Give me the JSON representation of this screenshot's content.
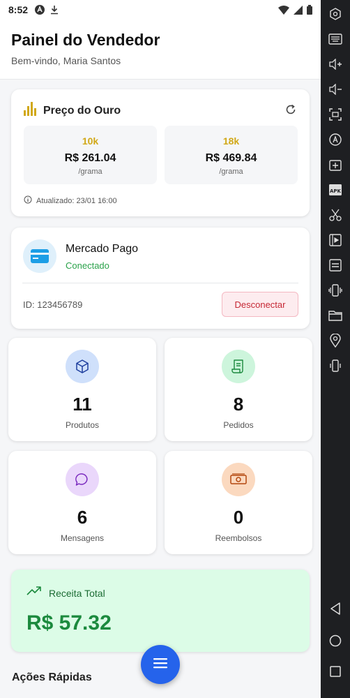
{
  "status_bar": {
    "time": "8:52"
  },
  "header": {
    "title": "Painel do Vendedor",
    "subtitle": "Bem-vindo, Maria Santos"
  },
  "gold": {
    "title": "Preço do Ouro",
    "prices": [
      {
        "karat": "10k",
        "price": "R$ 261.04",
        "unit": "/grama"
      },
      {
        "karat": "18k",
        "price": "R$ 469.84",
        "unit": "/grama"
      }
    ],
    "updated": "Atualizado: 23/01 16:00",
    "accent_color": "#d1a817"
  },
  "mercado_pago": {
    "name": "Mercado Pago",
    "status": "Conectado",
    "id_text": "ID: 123456789",
    "disconnect_label": "Desconectar"
  },
  "stats": [
    {
      "value": "11",
      "label": "Produtos",
      "icon": "box-icon",
      "color": "#cfe0fb"
    },
    {
      "value": "8",
      "label": "Pedidos",
      "icon": "receipt-icon",
      "color": "#cdf5dc"
    },
    {
      "value": "6",
      "label": "Mensagens",
      "icon": "chat-bubble-icon",
      "color": "#ead7fb"
    },
    {
      "value": "0",
      "label": "Reembolsos",
      "icon": "money-icon",
      "color": "#fbd9bf"
    }
  ],
  "revenue": {
    "title": "Receita Total",
    "value": "R$ 57.32"
  },
  "quick_actions": {
    "title": "Ações Rápidas"
  }
}
